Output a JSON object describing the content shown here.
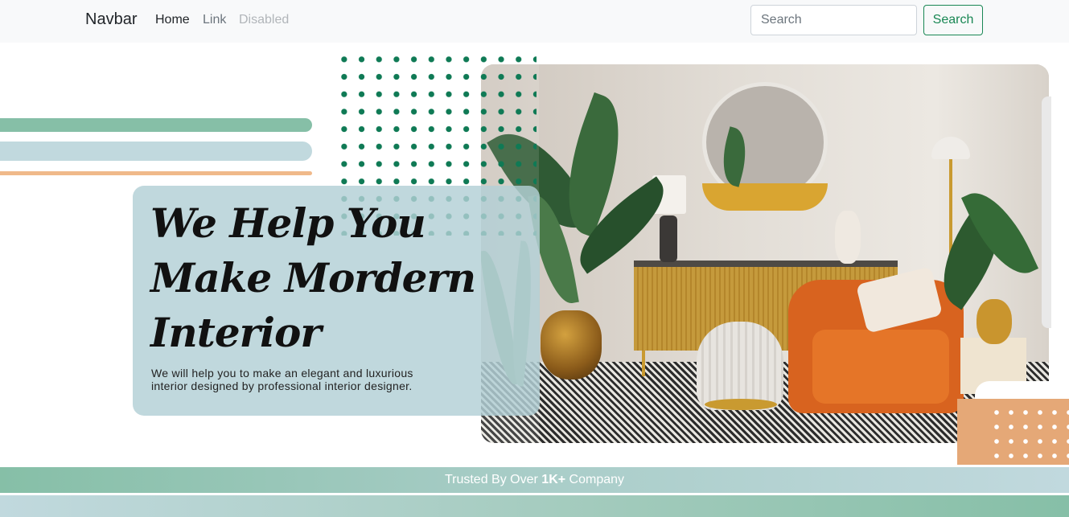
{
  "navbar": {
    "brand": "Navbar",
    "links": [
      "Home",
      "Link",
      "Disabled"
    ],
    "search_placeholder": "Search",
    "search_button": "Search"
  },
  "hero": {
    "title_lines": [
      "We Help You",
      "Make Mordern",
      "Interior"
    ],
    "subtitle_line1": "We will help you to make an elegant and luxurious",
    "subtitle_line2": "interior designed by professional interior designer."
  },
  "trusted": {
    "prefix": "Trusted By Over",
    "highlight": "1K+",
    "suffix": "Company"
  },
  "colors": {
    "accent_green": "#86bfa7",
    "accent_blue": "#c1d9de",
    "accent_orange": "#e5a877",
    "dot_green": "#0f7a55",
    "button_green": "#198754"
  },
  "icons": [
    "interior-photo"
  ]
}
